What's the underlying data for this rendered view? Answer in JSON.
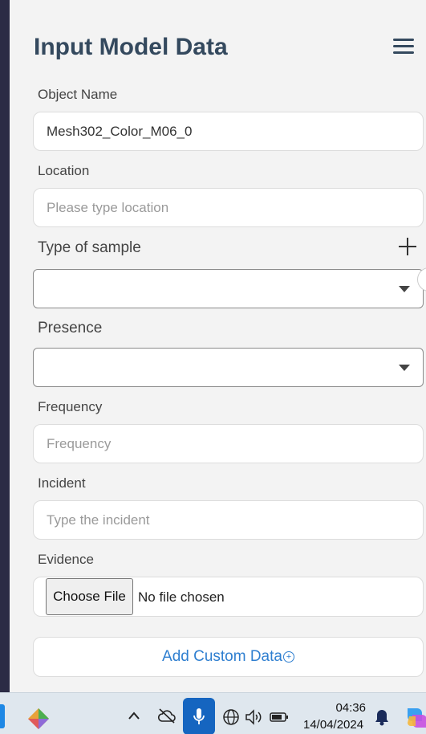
{
  "page": {
    "title": "Input Model Data"
  },
  "form": {
    "object_name": {
      "label": "Object Name",
      "value": "Mesh302_Color_M06_0",
      "placeholder": ""
    },
    "location": {
      "label": "Location",
      "value": "",
      "placeholder": "Please type location"
    },
    "type_of_sample": {
      "label": "Type of sample",
      "selected": ""
    },
    "presence": {
      "label": "Presence",
      "selected": ""
    },
    "frequency": {
      "label": "Frequency",
      "value": "",
      "placeholder": "Frequency"
    },
    "incident": {
      "label": "Incident",
      "value": "",
      "placeholder": "Type the incident"
    },
    "evidence": {
      "label": "Evidence",
      "button_label": "Choose File",
      "status": "No file chosen"
    },
    "add_custom_data": {
      "label": "Add Custom Data",
      "icon": "plus-circle-icon"
    }
  },
  "taskbar": {
    "time": "04:36",
    "date": "14/04/2024",
    "accent_color": "#1565c0"
  }
}
